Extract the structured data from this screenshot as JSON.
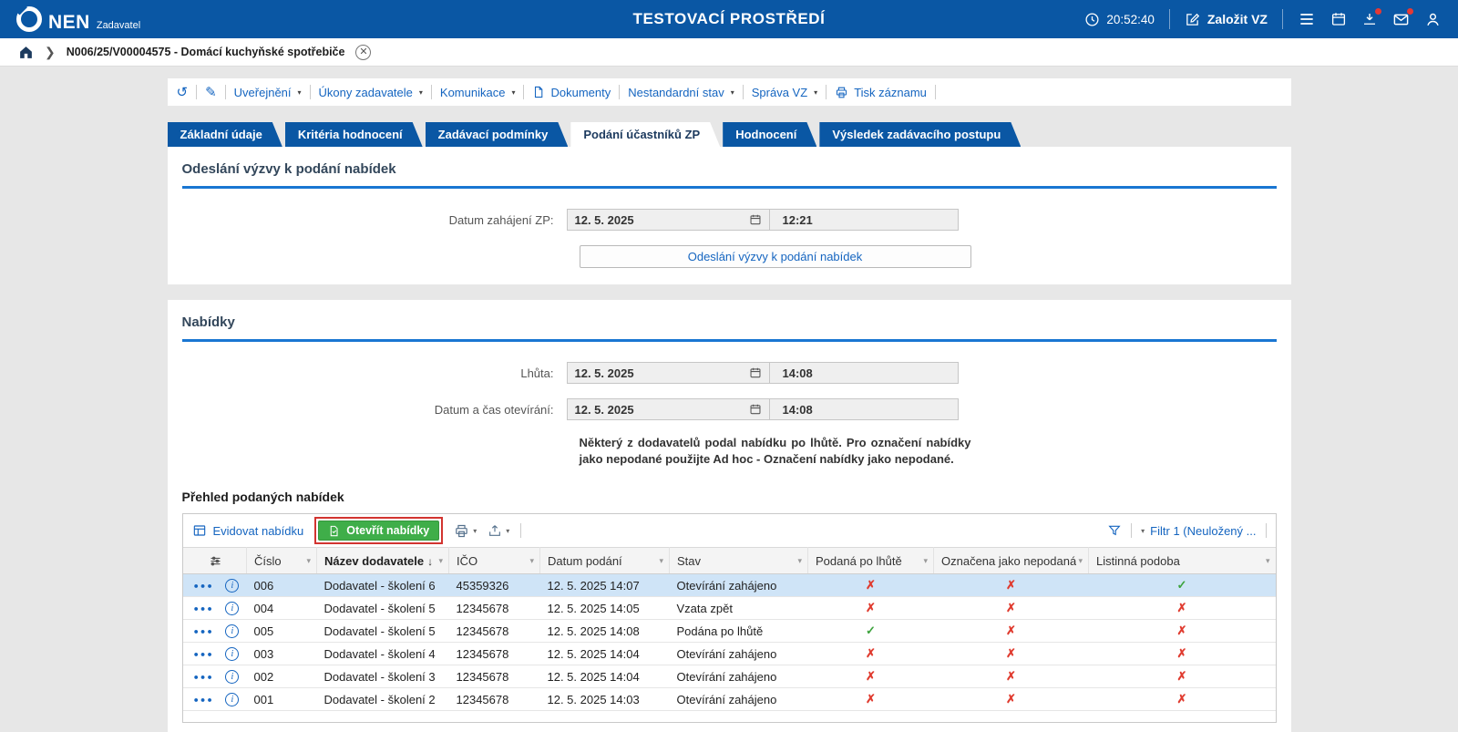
{
  "topbar": {
    "brand": "NEN",
    "brand_sub": "Zadavatel",
    "title": "TESTOVACÍ PROSTŘEDÍ",
    "clock": "20:52:40",
    "new_vz_label": "Založit VZ"
  },
  "breadcrumb": {
    "record": "N006/25/V00004575 - Domácí kuchyňské spotřebiče"
  },
  "record_toolbar": {
    "items": [
      {
        "label": "Uveřejnění"
      },
      {
        "label": "Úkony zadavatele"
      },
      {
        "label": "Komunikace"
      },
      {
        "label": "Dokumenty"
      },
      {
        "label": "Nestandardní stav"
      },
      {
        "label": "Správa VZ"
      },
      {
        "label": "Tisk záznamu"
      }
    ]
  },
  "tabs": [
    "Základní údaje",
    "Kritéria hodnocení",
    "Zadávací podmínky",
    "Podání účastníků ZP",
    "Hodnocení",
    "Výsledek zadávacího postupu"
  ],
  "active_tab": "Podání účastníků ZP",
  "send_section": {
    "title": "Odeslání výzvy k podání nabídek",
    "label": "Datum zahájení ZP:",
    "date": "12. 5. 2025",
    "time": "12:21",
    "button_label": "Odeslání výzvy k podání nabídek"
  },
  "offers_section": {
    "title": "Nabídky",
    "deadline_label": "Lhůta:",
    "deadline_date": "12. 5. 2025",
    "deadline_time": "14:08",
    "opening_label": "Datum a čas otevírání:",
    "opening_date": "12. 5. 2025",
    "opening_time": "14:08",
    "warning": "Některý z dodavatelů podal nabídku po lhůtě. Pro označení nabídky jako nepodané použijte Ad hoc - Označení nabídky jako nepodané.",
    "table_title": "Přehled podaných nabídek",
    "grid_toolbar": {
      "evidovat_label": "Evidovat nabídku",
      "otevrit_label": "Otevřít nabídky",
      "filter_label": "Filtr 1 (Neuložený ..."
    }
  },
  "offers_table": {
    "columns": [
      "Číslo",
      "Název dodavatele",
      "IČO",
      "Datum podání",
      "Stav",
      "Podaná po lhůtě",
      "Označena jako nepodaná",
      "Listinná podoba"
    ],
    "sorted_column": "Název dodavatele",
    "rows": [
      {
        "cislo": "006",
        "nazev": "Dodavatel - školení 6",
        "ico": "45359326",
        "datum": "12. 5. 2025 14:07",
        "stav": "Otevírání zahájeno",
        "po_lhute": false,
        "nepodana": false,
        "listinna": true,
        "selected": true
      },
      {
        "cislo": "004",
        "nazev": "Dodavatel - školení 5",
        "ico": "12345678",
        "datum": "12. 5. 2025 14:05",
        "stav": "Vzata zpět",
        "po_lhute": false,
        "nepodana": false,
        "listinna": false,
        "selected": false
      },
      {
        "cislo": "005",
        "nazev": "Dodavatel - školení 5",
        "ico": "12345678",
        "datum": "12. 5. 2025 14:08",
        "stav": "Podána po lhůtě",
        "po_lhute": true,
        "nepodana": false,
        "listinna": false,
        "selected": false
      },
      {
        "cislo": "003",
        "nazev": "Dodavatel - školení 4",
        "ico": "12345678",
        "datum": "12. 5. 2025 14:04",
        "stav": "Otevírání zahájeno",
        "po_lhute": false,
        "nepodana": false,
        "listinna": false,
        "selected": false
      },
      {
        "cislo": "002",
        "nazev": "Dodavatel - školení 3",
        "ico": "12345678",
        "datum": "12. 5. 2025 14:04",
        "stav": "Otevírání zahájeno",
        "po_lhute": false,
        "nepodana": false,
        "listinna": false,
        "selected": false
      },
      {
        "cislo": "001",
        "nazev": "Dodavatel - školení 2",
        "ico": "12345678",
        "datum": "12. 5. 2025 14:03",
        "stav": "Otevírání zahájeno",
        "po_lhute": false,
        "nepodana": false,
        "listinna": false,
        "selected": false
      }
    ]
  }
}
